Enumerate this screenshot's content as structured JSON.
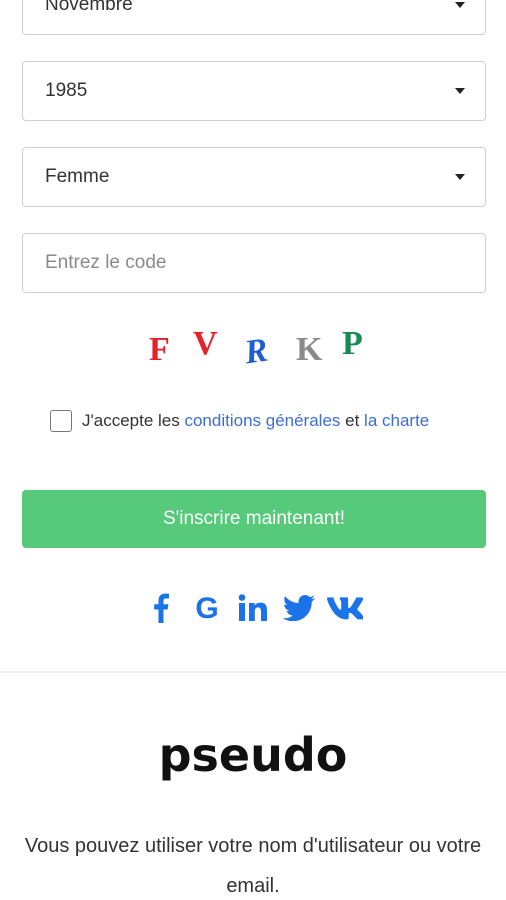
{
  "form": {
    "month_select": {
      "value": "Novembre"
    },
    "year_select": {
      "value": "1985"
    },
    "gender_select": {
      "value": "Femme"
    },
    "code_input": {
      "placeholder": "Entrez le code"
    },
    "captcha": [
      {
        "char": "F",
        "color": "#e8202a"
      },
      {
        "char": "V",
        "color": "#e8202a"
      },
      {
        "char": "R",
        "color": "#1f5fd0"
      },
      {
        "char": "K",
        "color": "#8a8a8a"
      },
      {
        "char": "P",
        "color": "#1a8a55"
      }
    ],
    "terms": {
      "prefix": "J'accepte les ",
      "conditions_link": "conditions générales",
      "middle": " et ",
      "charter_link": "la charte"
    },
    "submit_label": "S'inscrire maintenant!"
  },
  "social": {
    "color": "#1a73e8",
    "icons": [
      "facebook-icon",
      "google-icon",
      "linkedin-icon",
      "twitter-icon",
      "vk-icon"
    ]
  },
  "info": {
    "title": "pseudo",
    "description": "Vous pouvez utiliser votre nom d'utilisateur ou votre email."
  }
}
